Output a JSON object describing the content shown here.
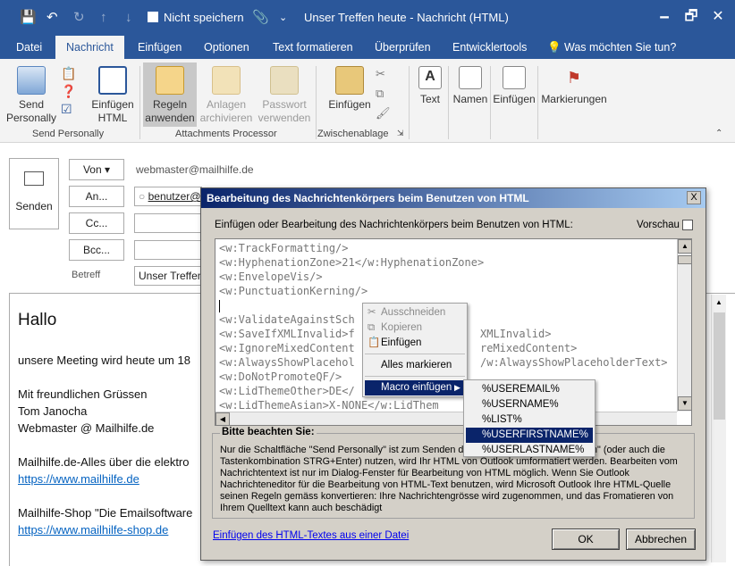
{
  "window": {
    "title": "Unser Treffen heute  -  Nachricht (HTML)",
    "dont_save_label": "Nicht speichern",
    "minimize": "🗕",
    "restore": "🗗",
    "close": "✕"
  },
  "menu": {
    "tabs": [
      "Datei",
      "Nachricht",
      "Einfügen",
      "Optionen",
      "Text formatieren",
      "Überprüfen",
      "Entwicklertools"
    ],
    "tell_me": "Was möchten Sie tun?"
  },
  "ribbon": {
    "send_personally": "Send Personally",
    "einfuegen_html": "Einfügen HTML",
    "regeln_anwenden": "Regeln anwenden",
    "anlagen_archivieren": "Anlagen archivieren",
    "passwort_verwenden": "Passwort verwenden",
    "einfuegen": "Einfügen",
    "text": "Text",
    "namen": "Namen",
    "einfuegen2": "Einfügen",
    "markierungen": "Markierungen",
    "groups": {
      "send_personally": "Send Personally",
      "attachments": "Attachments Processor",
      "zwischenablage": "Zwischenablage"
    }
  },
  "compose": {
    "send_label": "Senden",
    "von_label": "Von",
    "from_address": "webmaster@mailhilfe.de",
    "an_label": "An...",
    "to_value": "benutzer@",
    "cc_label": "Cc...",
    "bcc_label": "Bcc...",
    "subject_label": "Betreff",
    "subject_value": "Unser Treffen"
  },
  "body": {
    "greeting": "Hallo",
    "line1": "unsere Meeting wird heute um 18",
    "closing": "Mit freundlichen Grüssen",
    "name": "Tom Janocha",
    "signature": "Webmaster @ Mailhilfe.de",
    "company": "Mailhilfe.de-Alles über die elektro",
    "link1": "https://www.mailhilfe.de",
    "shop": "Mailhilfe-Shop \"Die Emailsoftware",
    "link2": "https://www.mailhilfe-shop.de"
  },
  "dialog": {
    "title": "Bearbeitung des Nachrichtenkörpers beim Benutzen von HTML",
    "close": "X",
    "instruction": "Einfügen oder Bearbeitung des Nachrichtenkörpers beim Benutzen von HTML:",
    "preview_label": "Vorschau",
    "code_lines": [
      "<w:TrackFormatting/>",
      "<w:HyphenationZone>21</w:HyphenationZone>",
      "<w:EnvelopeVis/>",
      "<w:PunctuationKerning/>",
      "",
      "<w:ValidateAgainstSch",
      "<w:SaveIfXMLInvalid>f",
      "<w:IgnoreMixedContent",
      "<w:AlwaysShowPlacehol",
      "<w:DoNotPromoteQF/>",
      "<w:LidThemeOther>DE</",
      "<w:LidThemeAsian>X-NONE</w:LidThem"
    ],
    "code_tails": [
      {
        "row": 6,
        "text": "XMLInvalid>"
      },
      {
        "row": 7,
        "text": "reMixedContent>"
      },
      {
        "row": 8,
        "text": "/w:AlwaysShowPlaceholderText>"
      }
    ],
    "notice_title": "Bitte beachten Sie:",
    "notice_text": "Nur die Schaltfläche \"Send Personally\" ist zum Senden de die Standard-Option \"Senden\" (oder auch die Tastenkombination STRG+Enter) nutzen, wird Ihr HTML von Outlook umformatiert werden. Bearbeiten vom Nachrichtentext ist nur im Dialog-Fenster für Bearbeitung von HTML möglich. Wenn Sie Outlook Nachrichteneditor für die Bearbeitung von HTML-Text benutzen, wird Microsoft Outlook Ihre HTML-Quelle seinen Regeln gemäss konvertieren: Ihre Nachrichtengrösse wird zugenommen, und das Fromatieren von Ihrem Quelltext kann auch beschädigt",
    "insert_link": "Einfügen des HTML-Textes aus einer Datei",
    "ok": "OK",
    "cancel": "Abbrechen"
  },
  "context_menu": {
    "cut": "Ausschneiden",
    "copy": "Kopieren",
    "paste": "Einfügen",
    "select_all": "Alles markieren",
    "macro": "Macro einfügen"
  },
  "macro_submenu": {
    "items": [
      "%USEREMAIL%",
      "%USERNAME%",
      "%LIST%",
      "%USERFIRSTNAME%",
      "%USERLASTNAME%"
    ],
    "selected_index": 3
  },
  "colors": {
    "accent": "#2b579a",
    "dialog_title": "#0a246a",
    "link": "#0563c1"
  }
}
